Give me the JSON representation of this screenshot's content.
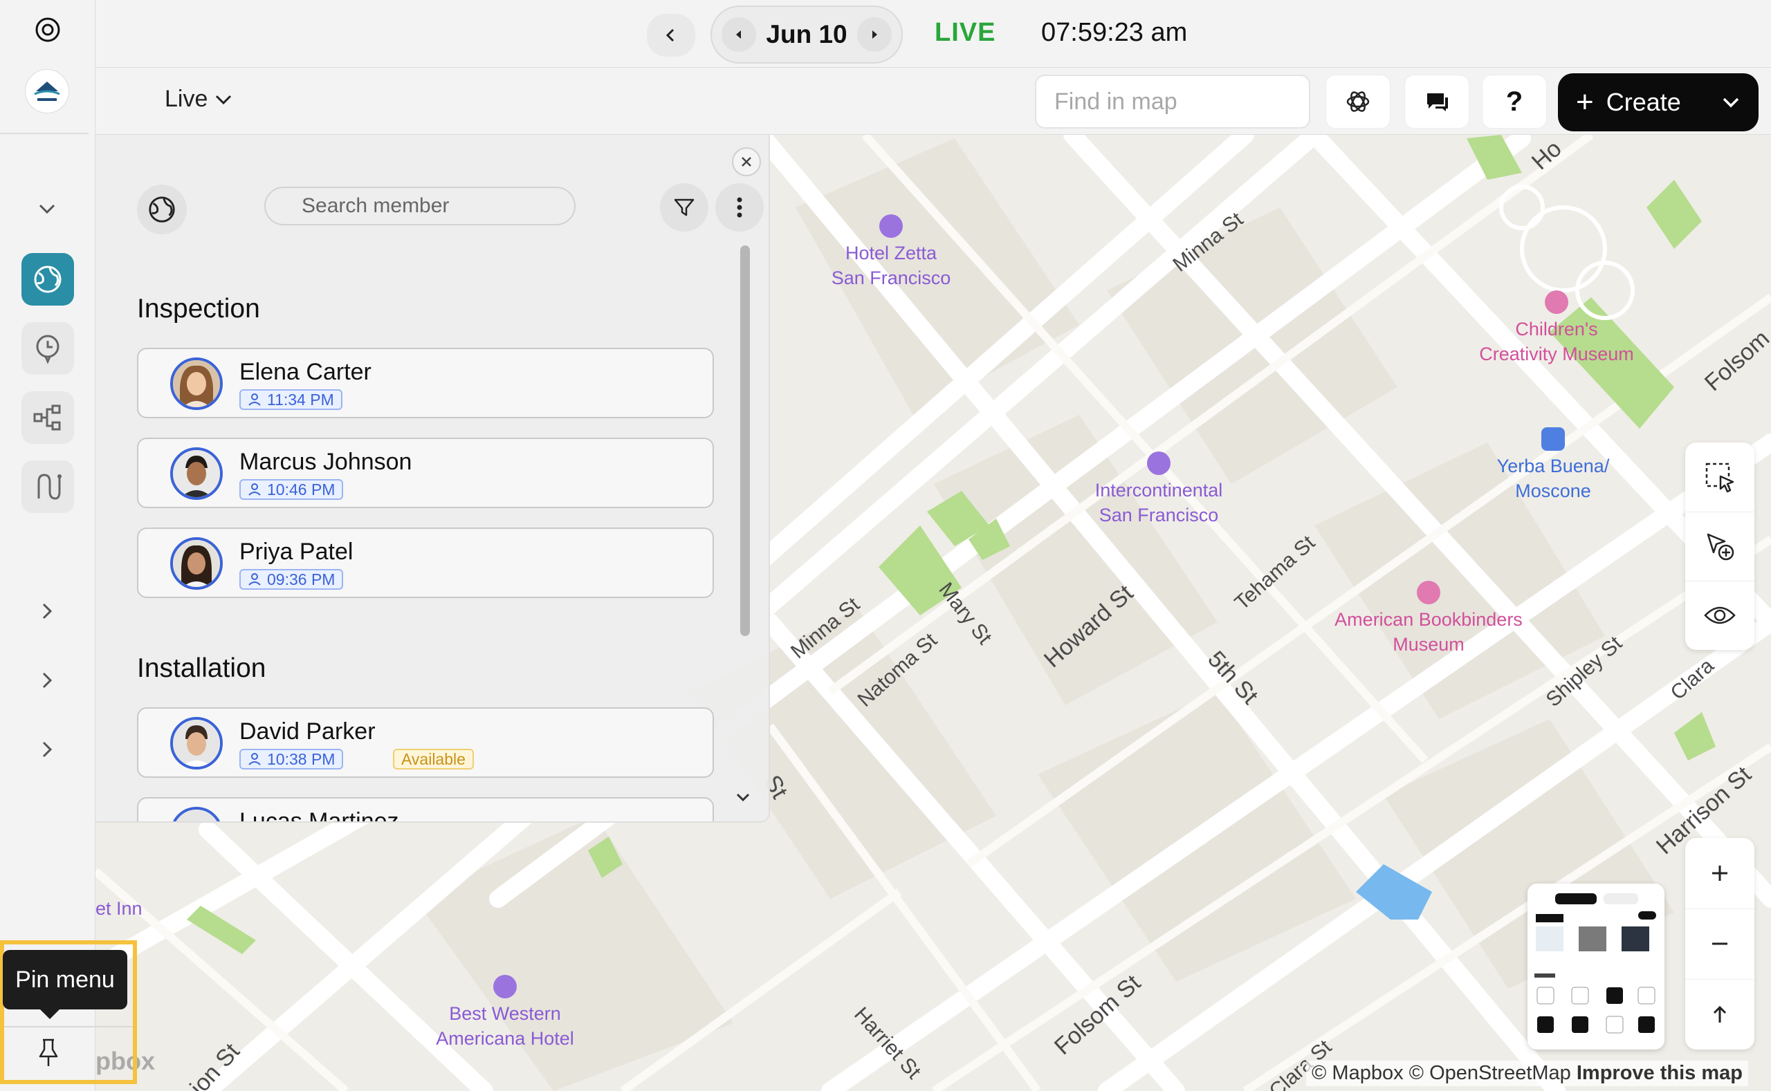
{
  "topbar": {
    "date": "Jun 10",
    "live": "LIVE",
    "clock": "07:59:23 am"
  },
  "subbar": {
    "mode": "Live",
    "find_placeholder": "Find in map",
    "help_label": "?",
    "create_label": "Create"
  },
  "panel": {
    "search_placeholder": "Search member",
    "groups": [
      {
        "title": "Inspection",
        "members": [
          {
            "name": "Elena Carter",
            "time": "11:34 PM"
          },
          {
            "name": "Marcus Johnson",
            "time": "10:46 PM"
          },
          {
            "name": "Priya Patel",
            "time": "09:36 PM"
          }
        ]
      },
      {
        "title": "Installation",
        "members": [
          {
            "name": "David Parker",
            "time": "10:38 PM",
            "badge": "Available"
          },
          {
            "name": "Lucas Martinez",
            "time": ""
          }
        ]
      }
    ]
  },
  "map": {
    "pois": {
      "hotel_zetta": "Hotel Zetta\nSan Francisco",
      "childrens_museum": "Children's\nCreativity Museum",
      "yerba_buena": "Yerba Buena/\nMoscone",
      "intercontinental": "Intercontinental\nSan Francisco",
      "bookbinders": "American Bookbinders\nMuseum",
      "best_western": "Best Western\nAmericana Hotel",
      "inn_fragment": "et Inn"
    },
    "streets": {
      "minna_top": "Minna St",
      "minna_left": "Minna St",
      "mary": "Mary St",
      "natoma": "Natoma St",
      "howard": "Howard St",
      "tehama": "Tehama St",
      "fifth": "5th St",
      "shipley": "Shipley St",
      "clara_right": "Clara",
      "harrison": "Harrison St",
      "folsom": "Folsom St",
      "folsom_right": "Folsom",
      "harriet": "Harriet St",
      "howard_top": "Ho",
      "st_fragment": "St",
      "ion_fragment": "ion St",
      "clara_bottom": "Clara St"
    },
    "attribution_a": "© Mapbox © OpenStreetMap",
    "attribution_b": "Improve this map",
    "logo_fragment": "pbox"
  },
  "pin_menu": {
    "tooltip": "Pin menu"
  },
  "colors": {
    "live_green": "#2aa63a",
    "accent_blue": "#3b63d8",
    "rail_active": "#2a8ea6",
    "create_bg": "#0b0b0b",
    "highlight_yellow": "#f5c23d",
    "poi_purple": "#8a5bd4",
    "poi_pink": "#d2509b"
  }
}
